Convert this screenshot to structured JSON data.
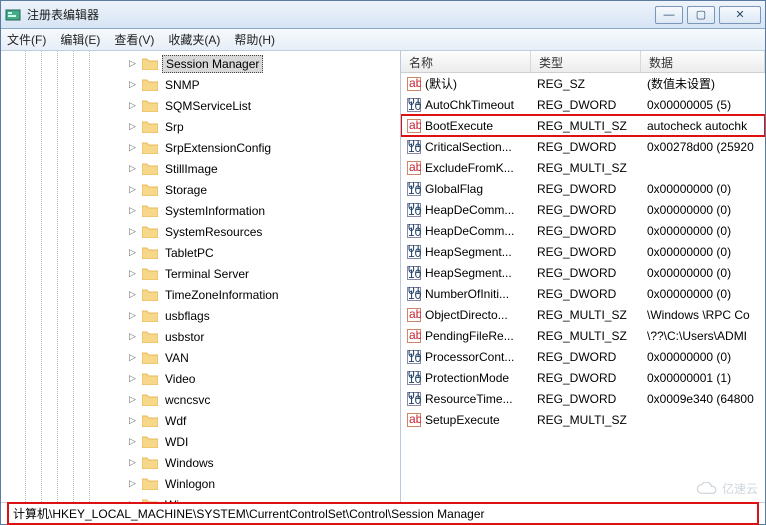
{
  "window": {
    "title": "注册表编辑器"
  },
  "win_controls": {
    "min": "—",
    "max": "▢",
    "close": "✕"
  },
  "menu": {
    "file": "文件(F)",
    "edit": "编辑(E)",
    "view": "查看(V)",
    "favorites": "收藏夹(A)",
    "help": "帮助(H)"
  },
  "tree": {
    "indent": 108,
    "items": [
      {
        "label": "Session Manager",
        "selected": true
      },
      {
        "label": "SNMP"
      },
      {
        "label": "SQMServiceList"
      },
      {
        "label": "Srp"
      },
      {
        "label": "SrpExtensionConfig"
      },
      {
        "label": "StillImage"
      },
      {
        "label": "Storage"
      },
      {
        "label": "SystemInformation"
      },
      {
        "label": "SystemResources"
      },
      {
        "label": "TabletPC"
      },
      {
        "label": "Terminal Server"
      },
      {
        "label": "TimeZoneInformation"
      },
      {
        "label": "usbflags"
      },
      {
        "label": "usbstor"
      },
      {
        "label": "VAN"
      },
      {
        "label": "Video"
      },
      {
        "label": "wcncsvc"
      },
      {
        "label": "Wdf"
      },
      {
        "label": "WDI"
      },
      {
        "label": "Windows"
      },
      {
        "label": "Winlogon"
      },
      {
        "label": "Winresume"
      }
    ]
  },
  "list": {
    "columns": {
      "name": "名称",
      "type": "类型",
      "data": "数据"
    },
    "rows": [
      {
        "icon": "str",
        "name": "(默认)",
        "type": "REG_SZ",
        "data": "(数值未设置)"
      },
      {
        "icon": "bin",
        "name": "AutoChkTimeout",
        "type": "REG_DWORD",
        "data": "0x00000005 (5)"
      },
      {
        "icon": "str",
        "name": "BootExecute",
        "type": "REG_MULTI_SZ",
        "data": "autocheck autochk",
        "highlight": true
      },
      {
        "icon": "bin",
        "name": "CriticalSection...",
        "type": "REG_DWORD",
        "data": "0x00278d00 (25920"
      },
      {
        "icon": "str",
        "name": "ExcludeFromK...",
        "type": "REG_MULTI_SZ",
        "data": ""
      },
      {
        "icon": "bin",
        "name": "GlobalFlag",
        "type": "REG_DWORD",
        "data": "0x00000000 (0)"
      },
      {
        "icon": "bin",
        "name": "HeapDeComm...",
        "type": "REG_DWORD",
        "data": "0x00000000 (0)"
      },
      {
        "icon": "bin",
        "name": "HeapDeComm...",
        "type": "REG_DWORD",
        "data": "0x00000000 (0)"
      },
      {
        "icon": "bin",
        "name": "HeapSegment...",
        "type": "REG_DWORD",
        "data": "0x00000000 (0)"
      },
      {
        "icon": "bin",
        "name": "HeapSegment...",
        "type": "REG_DWORD",
        "data": "0x00000000 (0)"
      },
      {
        "icon": "bin",
        "name": "NumberOfIniti...",
        "type": "REG_DWORD",
        "data": "0x00000000 (0)"
      },
      {
        "icon": "str",
        "name": "ObjectDirecto...",
        "type": "REG_MULTI_SZ",
        "data": "\\Windows \\RPC Co"
      },
      {
        "icon": "str",
        "name": "PendingFileRe...",
        "type": "REG_MULTI_SZ",
        "data": "\\??\\C:\\Users\\ADMI"
      },
      {
        "icon": "bin",
        "name": "ProcessorCont...",
        "type": "REG_DWORD",
        "data": "0x00000000 (0)"
      },
      {
        "icon": "bin",
        "name": "ProtectionMode",
        "type": "REG_DWORD",
        "data": "0x00000001 (1)"
      },
      {
        "icon": "bin",
        "name": "ResourceTime...",
        "type": "REG_DWORD",
        "data": "0x0009e340 (64800"
      },
      {
        "icon": "str",
        "name": "SetupExecute",
        "type": "REG_MULTI_SZ",
        "data": ""
      }
    ]
  },
  "statusbar": {
    "path": "计算机\\HKEY_LOCAL_MACHINE\\SYSTEM\\CurrentControlSet\\Control\\Session Manager"
  },
  "watermark": "亿速云",
  "colors": {
    "highlight_border": "#d11",
    "fold_a": "#f7d88a",
    "fold_b": "#e8b95a"
  }
}
